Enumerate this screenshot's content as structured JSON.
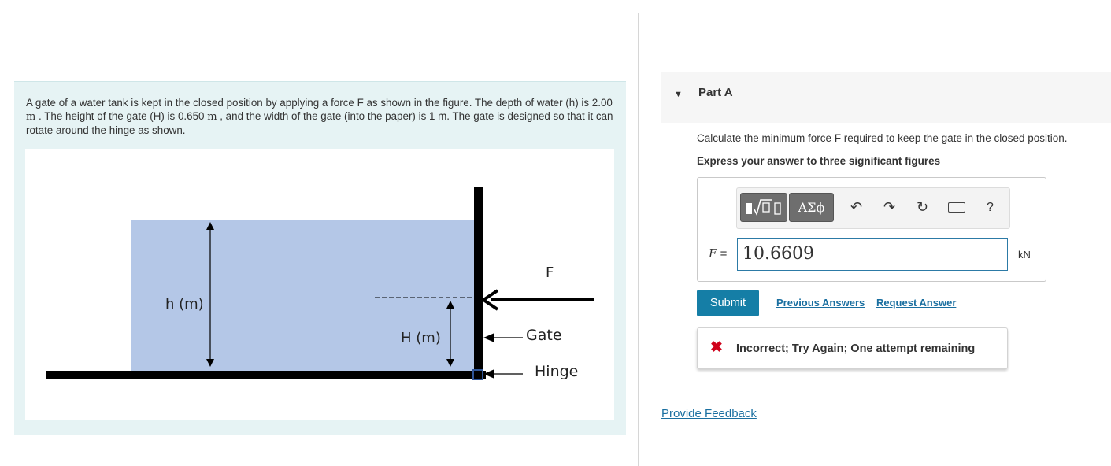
{
  "problem": {
    "text_part1": "A gate of a water tank is kept in the closed position by applying a force F as shown in the figure. The depth of water (h) is 2.00 ",
    "unit_m_1": "m",
    "text_part2": " . The height of the gate (H) is 0.650 ",
    "unit_m_2": "m",
    "text_part3": " , and the width of the gate (into the paper) is 1 m. The gate is designed so that it can rotate around the hinge as shown."
  },
  "figure": {
    "label_h": "h (m)",
    "label_H": "H (m)",
    "label_F": "F",
    "label_gate": "Gate",
    "label_hinge": "Hinge",
    "colors": {
      "water": "#b4c7e7",
      "wall": "#000000",
      "hinge": "#2f5597"
    }
  },
  "part": {
    "caret_icon": "caret-down-icon",
    "title": "Part A",
    "question": "Calculate the minimum force F required to keep the gate in the closed position.",
    "instruction": "Express your answer to three significant figures"
  },
  "toolbar": {
    "templates_icon": "templates-sqrt-icon",
    "greek_label": "ΑΣϕ",
    "undo_icon": "undo-icon",
    "redo_icon": "redo-icon",
    "reset_icon": "reset-icon",
    "keyboard_icon": "keyboard-icon",
    "help_label": "?"
  },
  "answer": {
    "variable": "F",
    "equals": " =",
    "value": "10.6609",
    "unit": "kN"
  },
  "actions": {
    "submit": "Submit",
    "previous_answers": "Previous Answers",
    "request_answer": "Request Answer"
  },
  "feedback": {
    "icon": "x-icon",
    "message": "Incorrect; Try Again; One attempt remaining",
    "color": "#d0021b"
  },
  "footer": {
    "provide_feedback": "Provide Feedback"
  }
}
